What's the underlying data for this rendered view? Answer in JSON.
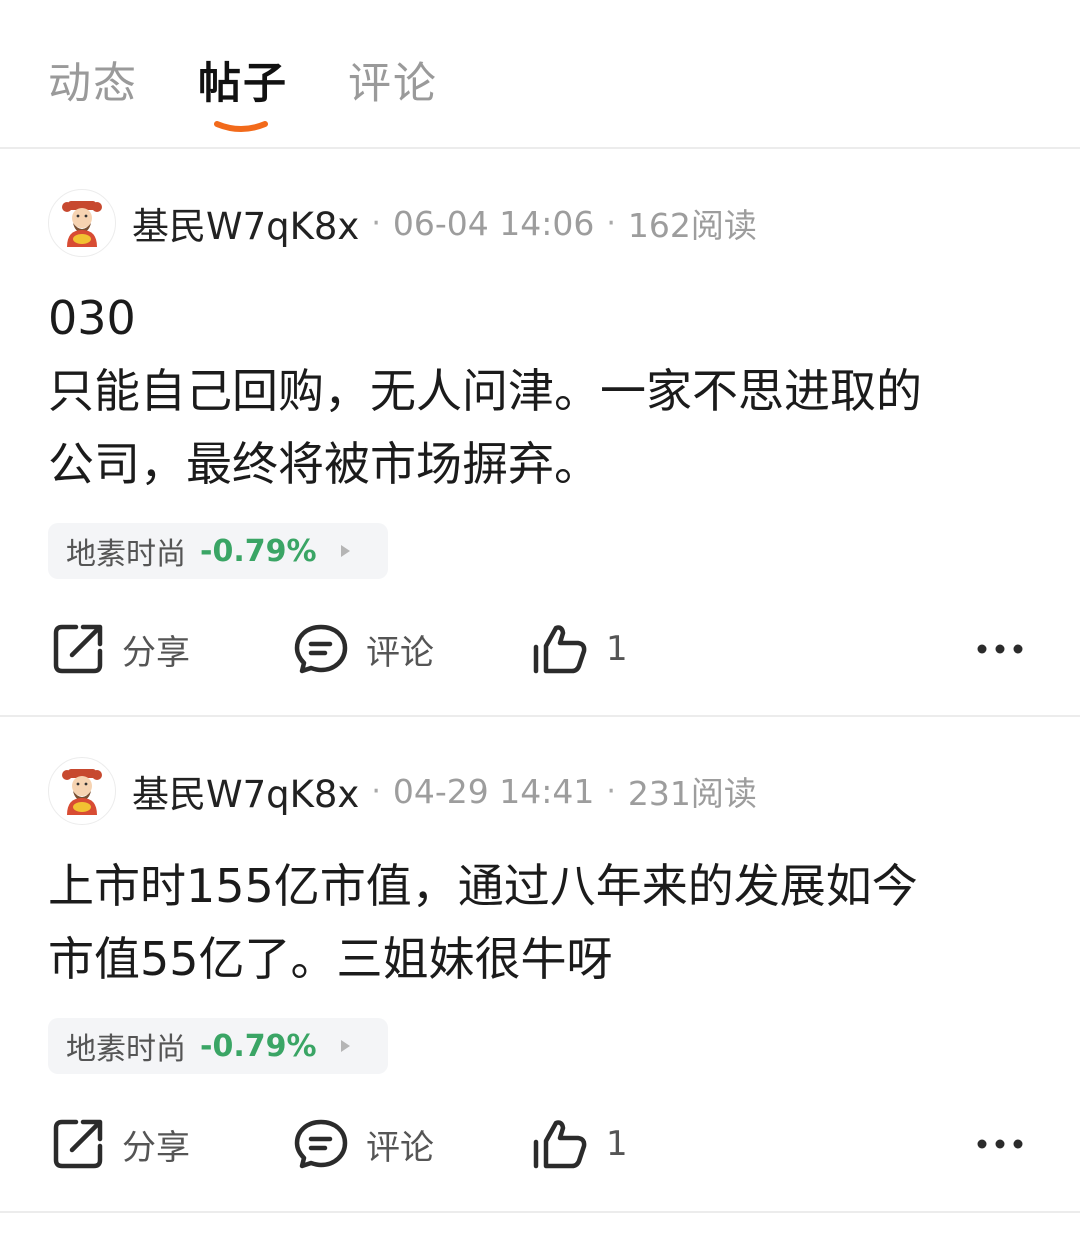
{
  "tabs": [
    {
      "label": "动态",
      "active": false
    },
    {
      "label": "帖子",
      "active": true
    },
    {
      "label": "评论",
      "active": false
    }
  ],
  "colors": {
    "accent": "#f26a1b",
    "stock_down": "#3aa565",
    "muted_text": "#9d9d9d",
    "tag_background": "#f4f5f7"
  },
  "posts": [
    {
      "username": "基民W7qK8x",
      "timestamp": "06-04 14:06",
      "reads": "162阅读",
      "content_lines": [
        "030",
        "只能自己回购，无人问津。一家不思进取的",
        "公司，最终将被市场摒弃。"
      ],
      "stock": {
        "name": "地素时尚",
        "change": "-0.79%"
      },
      "actions": {
        "share": "分享",
        "comment": "评论",
        "likes": "1"
      }
    },
    {
      "username": "基民W7qK8x",
      "timestamp": "04-29 14:41",
      "reads": "231阅读",
      "content_lines": [
        "上市时155亿市值，通过八年来的发展如今",
        "市值55亿了。三姐妹很牛呀"
      ],
      "stock": {
        "name": "地素时尚",
        "change": "-0.79%"
      },
      "actions": {
        "share": "分享",
        "comment": "评论",
        "likes": "1"
      }
    }
  ],
  "icons": {
    "avatar": "fortune-god-avatar-icon",
    "share": "share-icon",
    "comment": "comment-bubble-icon",
    "like": "thumbs-up-icon",
    "more": "more-dots-icon",
    "stock_arrow": "play-arrow-icon"
  }
}
